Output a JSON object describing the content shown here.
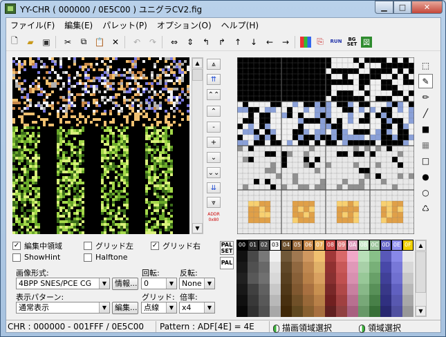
{
  "window": {
    "title": "YY-CHR ( 000000 / 0E5C00 ) ユニグラCV2.fig"
  },
  "menu": [
    "ファイル(F)",
    "編集(E)",
    "パレット(P)",
    "オプション(O)",
    "ヘルプ(H)"
  ],
  "toolbar": {
    "icons": [
      "new-icon",
      "open-icon",
      "save-icon",
      "cut-icon",
      "copy-icon",
      "paste-icon",
      "delete-icon",
      "undo-icon",
      "redo-icon",
      "flip-horizontal-icon",
      "flip-vertical-icon",
      "rotate-left-icon",
      "rotate-right-icon",
      "shift-up-icon",
      "shift-down-icon",
      "shift-left-icon",
      "shift-right-icon",
      "palette-icon",
      "copy-palette-icon",
      "run-icon",
      "bg-set-icon",
      "bookmark-icon"
    ],
    "run_label": "RUN",
    "bgset_label": "BG SET"
  },
  "nav": {
    "addr_label": "ADDR",
    "addr_value": "0x80"
  },
  "options": {
    "edit_area": "編集中領域",
    "edit_area_checked": true,
    "grid_left": "グリッド左",
    "grid_left_checked": false,
    "grid_right": "グリッド右",
    "grid_right_checked": true,
    "show_hint": "ShowHint",
    "show_hint_checked": false,
    "halftone": "Halftone",
    "halftone_checked": false
  },
  "format": {
    "label": "画像形式:",
    "value": "4BPP SNES/PCE CG",
    "info_button": "情報..."
  },
  "rotate": {
    "label": "回転:",
    "value": "0"
  },
  "mirror": {
    "label": "反転:",
    "value": "None"
  },
  "pattern": {
    "label": "表示パターン:",
    "value": "通常表示",
    "edit_button": "編集..."
  },
  "grid": {
    "label": "グリッド:",
    "value": "点線"
  },
  "zoom": {
    "label": "倍率:",
    "value": "x4"
  },
  "palette": {
    "tab_palset": "PAL SET",
    "tab_pal": "PAL",
    "indices": [
      "00",
      "01",
      "02",
      "03",
      "04",
      "05",
      "06",
      "07",
      "08",
      "09",
      "0A",
      "0B",
      "0C",
      "0D",
      "0E",
      "0F"
    ],
    "selected_index": "00",
    "header_colors": [
      "#000000",
      "#2a2a2a",
      "#4a4a4a",
      "#f8f8f8",
      "#6e5230",
      "#9a6a3c",
      "#c8884a",
      "#e8b060",
      "#c84848",
      "#e08080",
      "#e0a0c0",
      "#c8e8c8",
      "#a0c8a0",
      "#6868c8",
      "#9090f0",
      "#f0d000"
    ],
    "rows": [
      [
        "#101010",
        "#484848",
        "#787878",
        "#f0f0f0",
        "#705838",
        "#a07850",
        "#d09860",
        "#f0c070",
        "#a03838",
        "#d86868",
        "#f0a8c8",
        "#b8e0b8",
        "#88c088",
        "#5858b8",
        "#8888e8",
        "#e8e8e8"
      ],
      [
        "#181818",
        "#505050",
        "#686868",
        "#e0e0e0",
        "#604828",
        "#906840",
        "#c08850",
        "#e0b068",
        "#903030",
        "#c85858",
        "#e098b8",
        "#a8d0a8",
        "#78b078",
        "#4848a8",
        "#7878d8",
        "#d8d8d8"
      ],
      [
        "#202020",
        "#585858",
        "#707070",
        "#d8d8d8",
        "#584020",
        "#886038",
        "#b88048",
        "#d8a060",
        "#883030",
        "#c05050",
        "#d890b0",
        "#98c898",
        "#68a068",
        "#404098",
        "#7070d0",
        "#c8c8c8"
      ],
      [
        "#181818",
        "#404040",
        "#606060",
        "#c8c8c8",
        "#503818",
        "#805830",
        "#a87040",
        "#c89050",
        "#782828",
        "#b04848",
        "#c880a0",
        "#88b888",
        "#589058",
        "#383888",
        "#6060c0",
        "#b8b8b8"
      ],
      [
        "#101010",
        "#383838",
        "#585858",
        "#b8b8b8",
        "#483010",
        "#705028",
        "#986838",
        "#b88048",
        "#702020",
        "#a04040",
        "#b87090",
        "#78a878",
        "#488048",
        "#303080",
        "#5858b0",
        "#a8a8a8"
      ],
      [
        "#080808",
        "#303030",
        "#505050",
        "#a8a8a8",
        "#402808",
        "#604820",
        "#886030",
        "#a87040",
        "#602020",
        "#904040",
        "#a86080",
        "#689868",
        "#387038",
        "#282870",
        "#5050a0",
        "#989898"
      ]
    ]
  },
  "status": {
    "chr": "CHR : 000000 - 001FFF / 0E5C00",
    "pattern": "Pattern : ADF[4E] = 4E",
    "draw_select": "描画領域選択",
    "area_select": "領域選択"
  }
}
